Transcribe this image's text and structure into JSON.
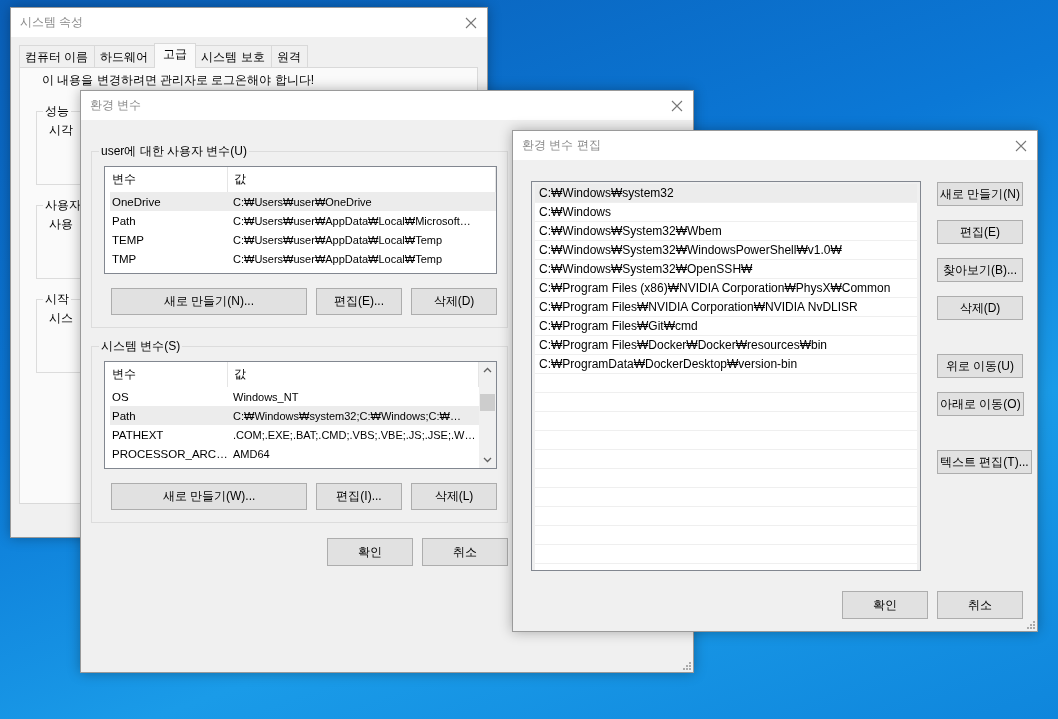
{
  "system_properties": {
    "title": "시스템 속성",
    "tabs": [
      {
        "label": "컴퓨터 이름",
        "selected": false
      },
      {
        "label": "하드웨어",
        "selected": false
      },
      {
        "label": "고급",
        "selected": true
      },
      {
        "label": "시스템 보호",
        "selected": false
      },
      {
        "label": "원격",
        "selected": false
      }
    ],
    "notice": "이 내용을 변경하려면 관리자로 로그온해야 합니다!",
    "groups": [
      {
        "label": "성능",
        "text": "시각"
      },
      {
        "label": "사용자",
        "text": "사용"
      },
      {
        "label": "시작",
        "text": "시스"
      }
    ]
  },
  "environment_variables": {
    "title": "환경 변수",
    "user_variables": {
      "label": "user에 대한 사용자 변수(U)",
      "columns": [
        "변수",
        "값"
      ],
      "rows": [
        {
          "name": "OneDrive",
          "value": "C:₩Users₩user₩OneDrive",
          "selected": true
        },
        {
          "name": "Path",
          "value": "C:₩Users₩user₩AppData₩Local₩Microsoft…",
          "selected": false
        },
        {
          "name": "TEMP",
          "value": "C:₩Users₩user₩AppData₩Local₩Temp",
          "selected": false
        },
        {
          "name": "TMP",
          "value": "C:₩Users₩user₩AppData₩Local₩Temp",
          "selected": false
        }
      ],
      "buttons": [
        "새로 만들기(N)...",
        "편집(E)...",
        "삭제(D)"
      ]
    },
    "system_variables": {
      "label": "시스템 변수(S)",
      "columns": [
        "변수",
        "값"
      ],
      "rows": [
        {
          "name": "OS",
          "value": "Windows_NT",
          "selected": false
        },
        {
          "name": "Path",
          "value": "C:₩Windows₩system32;C:₩Windows;C:₩…",
          "selected": true
        },
        {
          "name": "PATHEXT",
          "value": ".COM;.EXE;.BAT;.CMD;.VBS;.VBE;.JS;.JSE;.W…",
          "selected": false
        },
        {
          "name": "PROCESSOR_ARC…",
          "value": "AMD64",
          "selected": false
        }
      ],
      "buttons": [
        "새로 만들기(W)...",
        "편집(I)...",
        "삭제(L)"
      ]
    },
    "buttons": [
      "확인",
      "취소"
    ]
  },
  "edit_variable": {
    "title": "환경 변수 편집",
    "entries": [
      {
        "text": "C:₩Windows₩system32",
        "selected": true
      },
      {
        "text": "C:₩Windows",
        "selected": false
      },
      {
        "text": "C:₩Windows₩System32₩Wbem",
        "selected": false
      },
      {
        "text": "C:₩Windows₩System32₩WindowsPowerShell₩v1.0₩",
        "selected": false
      },
      {
        "text": "C:₩Windows₩System32₩OpenSSH₩",
        "selected": false
      },
      {
        "text": "C:₩Program Files (x86)₩NVIDIA Corporation₩PhysX₩Common",
        "selected": false
      },
      {
        "text": "C:₩Program Files₩NVIDIA Corporation₩NVIDIA NvDLISR",
        "selected": false
      },
      {
        "text": "C:₩Program Files₩Git₩cmd",
        "selected": false
      },
      {
        "text": "C:₩Program Files₩Docker₩Docker₩resources₩bin",
        "selected": false
      },
      {
        "text": "C:₩ProgramData₩DockerDesktop₩version-bin",
        "selected": false
      }
    ],
    "side_button_groups": [
      [
        "새로 만들기(N)",
        "편집(E)",
        "찾아보기(B)...",
        "삭제(D)"
      ],
      [
        "위로 이동(U)",
        "아래로 이동(O)"
      ],
      [
        "텍스트 편집(T)..."
      ]
    ],
    "buttons": [
      "확인",
      "취소"
    ]
  }
}
